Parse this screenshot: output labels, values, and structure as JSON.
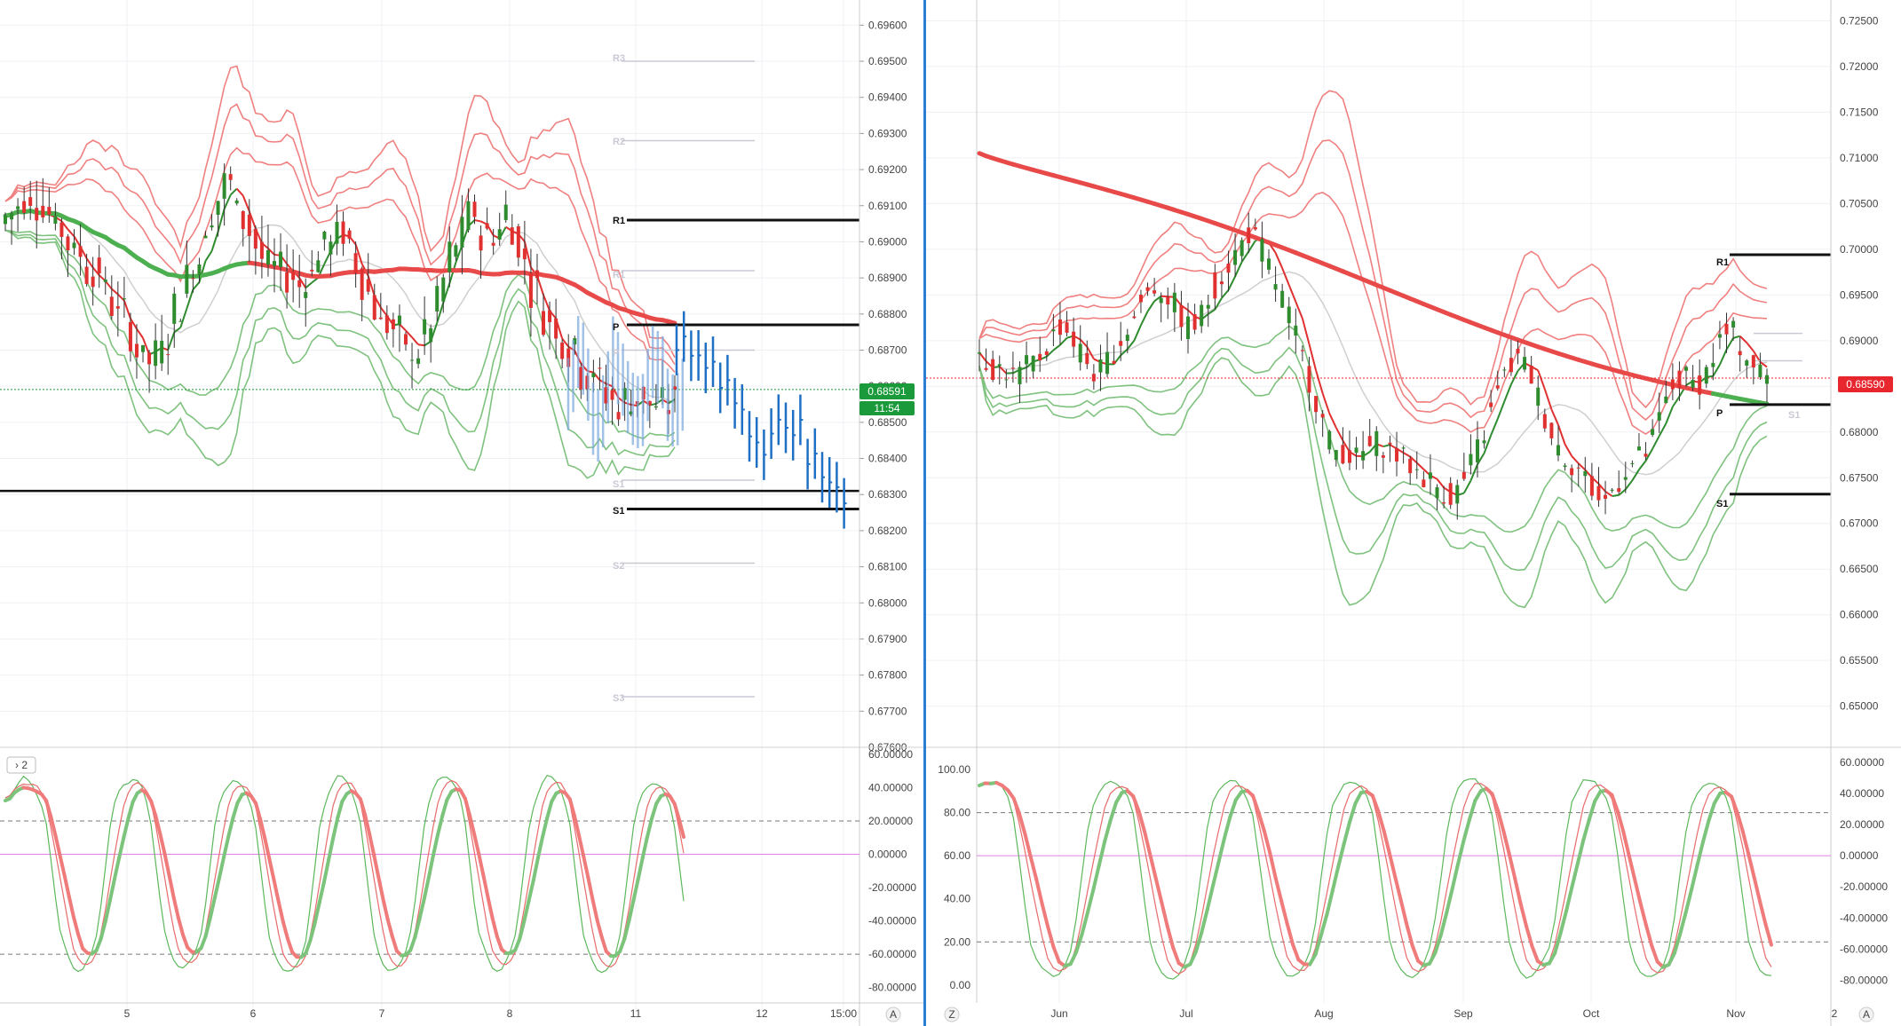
{
  "colors": {
    "bull": "#2e8b2e",
    "bear": "#e03030",
    "projection": "#1f6fc4",
    "band_upper": "#f08080",
    "band_lower": "#7fc27f",
    "mid_band": "#cfcfcf",
    "sma_red": "#e84a4a",
    "sma_green": "#4caf50",
    "pivot_solid": "#111111",
    "pivot_faint": "#c9c9d6",
    "grid": "#eef0f4",
    "price_tag_green": "#1a9a3a",
    "price_tag_red": "#e8262e",
    "divider": "#2a7fd4",
    "osc_fast": "#5cb85c",
    "osc_slow": "#e86b6b",
    "osc_thick_up": "#7cc47c",
    "osc_thick_down": "#ef7b7b",
    "zero_line": "#e080e0",
    "dash_line": "#777777"
  },
  "left_chart": {
    "price_ticks": [
      "0.69600",
      "0.69500",
      "0.69400",
      "0.69300",
      "0.69200",
      "0.69100",
      "0.69000",
      "0.68900",
      "0.68800",
      "0.68700",
      "0.68600",
      "0.68500",
      "0.68400",
      "0.68300",
      "0.68200",
      "0.68100",
      "0.68000",
      "0.67900",
      "0.67800",
      "0.67700",
      "0.67600"
    ],
    "time_labels": [
      "5",
      "6",
      "7",
      "8",
      "11",
      "12",
      "15:00"
    ],
    "axis_corner": "A",
    "current_price": "0.68591",
    "countdown": "11:54",
    "pivot_labels": {
      "r3": "R3",
      "r2": "R2",
      "r1": "R1",
      "r1_faint": "R1",
      "p": "P",
      "p_faint": "P",
      "s1": "S1",
      "s1_faint": "S1",
      "s2": "S2",
      "s3": "S3"
    },
    "indicator_badge": "› 2",
    "osc_ticks": [
      "60.00000",
      "40.00000",
      "20.00000",
      "0.00000",
      "-20.00000",
      "-40.00000",
      "-60.00000",
      "-80.00000"
    ]
  },
  "right_chart": {
    "price_ticks": [
      "0.72500",
      "0.72000",
      "0.71500",
      "0.71000",
      "0.70500",
      "0.70000",
      "0.69500",
      "0.69000",
      "0.68500",
      "0.68000",
      "0.67500",
      "0.67000",
      "0.66500",
      "0.66000",
      "0.65500",
      "0.65000"
    ],
    "time_labels": [
      "Jun",
      "Jul",
      "Aug",
      "Sep",
      "Oct",
      "Nov",
      "2"
    ],
    "axis_corner": "A",
    "left_corner": "Z",
    "current_price": "0.68590",
    "pivot_labels": {
      "r1": "R1",
      "p": "P",
      "s1": "S1",
      "s1_faint": "S1"
    },
    "osc_left_ticks": [
      "100.00",
      "80.00",
      "60.00",
      "40.00",
      "20.00",
      "0.00"
    ],
    "osc_right_ticks": [
      "60.00000",
      "40.00000",
      "20.00000",
      "0.00000",
      "-20.00000",
      "-40.00000",
      "-60.00000",
      "-80.00000"
    ]
  },
  "chart_data": [
    {
      "type": "line",
      "title": "",
      "price_range": [
        0.676,
        0.6965
      ],
      "candles_approx": [
        [
          0.6905,
          0.6915,
          0.6902,
          0.691
        ],
        [
          0.691,
          0.6918,
          0.6905,
          0.6913
        ],
        [
          0.6913,
          0.6916,
          0.6902,
          0.6905
        ],
        [
          0.6905,
          0.6908,
          0.6895,
          0.6898
        ],
        [
          0.6898,
          0.6902,
          0.6888,
          0.6892
        ],
        [
          0.6892,
          0.6896,
          0.688,
          0.6884
        ],
        [
          0.6884,
          0.689,
          0.687,
          0.6874
        ],
        [
          0.6874,
          0.6878,
          0.6862,
          0.6866
        ],
        [
          0.6866,
          0.6878,
          0.6863,
          0.6876
        ],
        [
          0.6876,
          0.6892,
          0.6873,
          0.689
        ],
        [
          0.689,
          0.6906,
          0.6886,
          0.6903
        ],
        [
          0.6903,
          0.692,
          0.69,
          0.6917
        ],
        [
          0.6917,
          0.6926,
          0.6905,
          0.6908
        ],
        [
          0.6908,
          0.6912,
          0.689,
          0.6894
        ],
        [
          0.6894,
          0.69,
          0.6886,
          0.6892
        ],
        [
          0.6892,
          0.6898,
          0.6884,
          0.6888
        ],
        [
          0.6888,
          0.69,
          0.6885,
          0.6897
        ],
        [
          0.6897,
          0.6907,
          0.6893,
          0.6903
        ],
        [
          0.6903,
          0.6908,
          0.689,
          0.6894
        ],
        [
          0.6894,
          0.6898,
          0.6878,
          0.6882
        ],
        [
          0.6882,
          0.6886,
          0.687,
          0.6874
        ],
        [
          0.6874,
          0.6878,
          0.6864,
          0.6868
        ],
        [
          0.6868,
          0.688,
          0.6865,
          0.6877
        ],
        [
          0.6877,
          0.6898,
          0.6874,
          0.6895
        ],
        [
          0.6895,
          0.6912,
          0.6891,
          0.6908
        ],
        [
          0.6908,
          0.6914,
          0.6896,
          0.69
        ],
        [
          0.69,
          0.6912,
          0.6896,
          0.6908
        ],
        [
          0.6908,
          0.6912,
          0.689,
          0.6894
        ],
        [
          0.6894,
          0.6898,
          0.6876,
          0.688
        ],
        [
          0.688,
          0.6886,
          0.6868,
          0.6874
        ],
        [
          0.6874,
          0.6878,
          0.6862,
          0.6866
        ],
        [
          0.6866,
          0.687,
          0.6856,
          0.686
        ],
        [
          0.686,
          0.6864,
          0.685,
          0.6854
        ],
        [
          0.6854,
          0.6862,
          0.685,
          0.6858
        ],
        [
          0.6858,
          0.6862,
          0.6849,
          0.6853
        ],
        [
          0.6853,
          0.686,
          0.685,
          0.6859
        ]
      ],
      "projection_approx": [
        0.6872,
        0.6868,
        0.6866,
        0.6862,
        0.6856,
        0.6846,
        0.6844,
        0.685,
        0.6848,
        0.684,
        0.6834,
        0.683
      ],
      "pivots": {
        "R3": 0.695,
        "R2": 0.6928,
        "R1": 0.6906,
        "R1 (faint)": 0.6892,
        "P": 0.6877,
        "P (faint)": 0.687,
        "S1 (faint)": 0.6834,
        "S1": 0.6826,
        "S2": 0.6811,
        "S3": 0.6774
      },
      "horizontal_line": 0.6831,
      "oscillator_range": [
        -85,
        60
      ]
    },
    {
      "type": "line",
      "title": "",
      "price_range": [
        0.6455,
        0.7265
      ],
      "x_labels": [
        "Jun",
        "Jul",
        "Aug",
        "Sep",
        "Oct",
        "Nov"
      ],
      "closes_approx": [
        0.689,
        0.687,
        0.687,
        0.686,
        0.687,
        0.688,
        0.69,
        0.692,
        0.69,
        0.688,
        0.686,
        0.688,
        0.69,
        0.692,
        0.695,
        0.696,
        0.695,
        0.693,
        0.691,
        0.693,
        0.696,
        0.698,
        0.7,
        0.702,
        0.7,
        0.697,
        0.694,
        0.69,
        0.686,
        0.682,
        0.678,
        0.678,
        0.677,
        0.678,
        0.679,
        0.678,
        0.677,
        0.676,
        0.675,
        0.674,
        0.673,
        0.674,
        0.677,
        0.68,
        0.684,
        0.687,
        0.688,
        0.686,
        0.682,
        0.679,
        0.677,
        0.676,
        0.674,
        0.672,
        0.674,
        0.676,
        0.677,
        0.678,
        0.682,
        0.685,
        0.686,
        0.685,
        0.687,
        0.69,
        0.691,
        0.689,
        0.687,
        0.686
      ],
      "pivots": {
        "R1": 0.6994,
        "P": 0.683,
        "S1 (faint)": 0.6831,
        "S1": 0.6732
      },
      "oscillator_left_range": [
        -5,
        107
      ],
      "oscillator_right_range": [
        -90,
        65
      ]
    }
  ]
}
